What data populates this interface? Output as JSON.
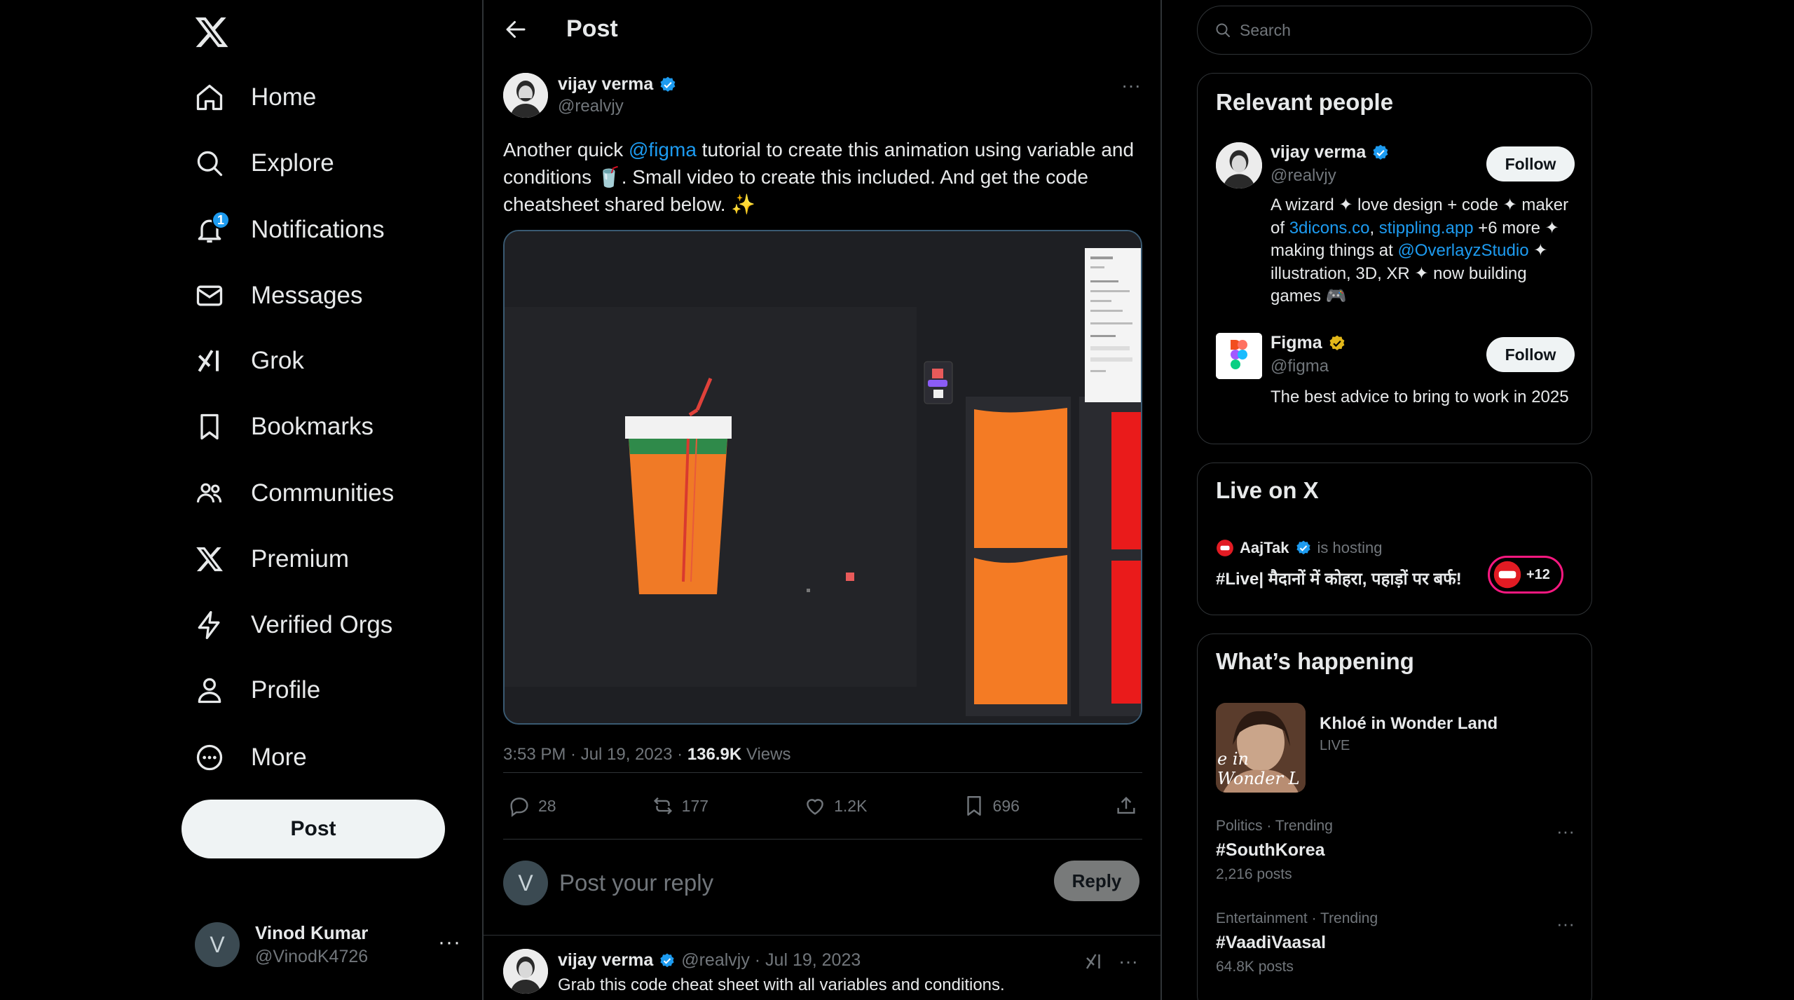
{
  "nav": {
    "items": [
      {
        "label": "Home",
        "icon": "home-icon"
      },
      {
        "label": "Explore",
        "icon": "search-icon"
      },
      {
        "label": "Notifications",
        "icon": "bell-icon",
        "badge": "1"
      },
      {
        "label": "Messages",
        "icon": "mail-icon"
      },
      {
        "label": "Grok",
        "icon": "grok-icon"
      },
      {
        "label": "Bookmarks",
        "icon": "bookmark-icon"
      },
      {
        "label": "Communities",
        "icon": "people-icon"
      },
      {
        "label": "Premium",
        "icon": "x-icon"
      },
      {
        "label": "Verified Orgs",
        "icon": "lightning-icon"
      },
      {
        "label": "Profile",
        "icon": "person-icon"
      },
      {
        "label": "More",
        "icon": "more-circle-icon"
      }
    ],
    "post_button": "Post",
    "account": {
      "initial": "V",
      "name": "Vinod Kumar",
      "handle": "@VinodK4726",
      "menu": "···"
    }
  },
  "main": {
    "header_title": "Post",
    "post": {
      "author_name": "vijay verma",
      "author_handle": "@realvjy",
      "text_1": "Another quick ",
      "mention": "@figma",
      "text_2": " tutorial to create this animation using variable and conditions 🥤.  Small video to create this included. And get the code cheatsheet shared below. ✨",
      "time": "3:53 PM · Jul 19, 2023 · ",
      "views_count": "136.9K",
      "views_label": " Views",
      "replies": "28",
      "reposts": "177",
      "likes": "1.2K",
      "bookmarks": "696"
    },
    "reply_box": {
      "initial": "V",
      "placeholder": "Post your reply",
      "button": "Reply"
    },
    "reply": {
      "author_name": "vijay verma",
      "meta": "@realvjy · Jul 19, 2023",
      "text": "Grab this code cheat sheet with all variables and conditions."
    }
  },
  "right": {
    "search_placeholder": "Search",
    "relevant": {
      "title": "Relevant people",
      "people": [
        {
          "name": "vijay verma",
          "handle": "@realvjy",
          "follow": "Follow",
          "bio_1": "A wizard ✦ love design + code ✦ maker of ",
          "link_1": "3dicons.co",
          "bio_2": ", ",
          "link_2": "stippling.app",
          "bio_3": " +6 more ✦ making things at ",
          "link_3": "@OverlayzStudio",
          "bio_4": " ✦ illustration, 3D, XR ✦ now building games 🎮"
        },
        {
          "name": "Figma",
          "handle": "@figma",
          "follow": "Follow",
          "bio": "The best advice to bring to work in 2025"
        }
      ]
    },
    "live": {
      "title": "Live on X",
      "host": "AajTak",
      "hosting": "is hosting",
      "stream_title": "#Live| मैदानों में कोहरा, पहाड़ों पर बर्फ!",
      "count": "+12"
    },
    "happening": {
      "title": "What’s happening",
      "featured": {
        "title": "Khloé in Wonder Land",
        "status": "LIVE",
        "caption": "e in Wonder L"
      },
      "trends": [
        {
          "category": "Politics · Trending",
          "name": "#SouthKorea",
          "count": "2,216 posts"
        },
        {
          "category": "Entertainment · Trending",
          "name": "#VaadiVaasal",
          "count": "64.8K posts"
        }
      ]
    }
  },
  "colors": {
    "accent": "#1d9bf0",
    "background": "#000000",
    "border": "#2f3336",
    "muted": "#71767b",
    "live": "#f91880"
  }
}
